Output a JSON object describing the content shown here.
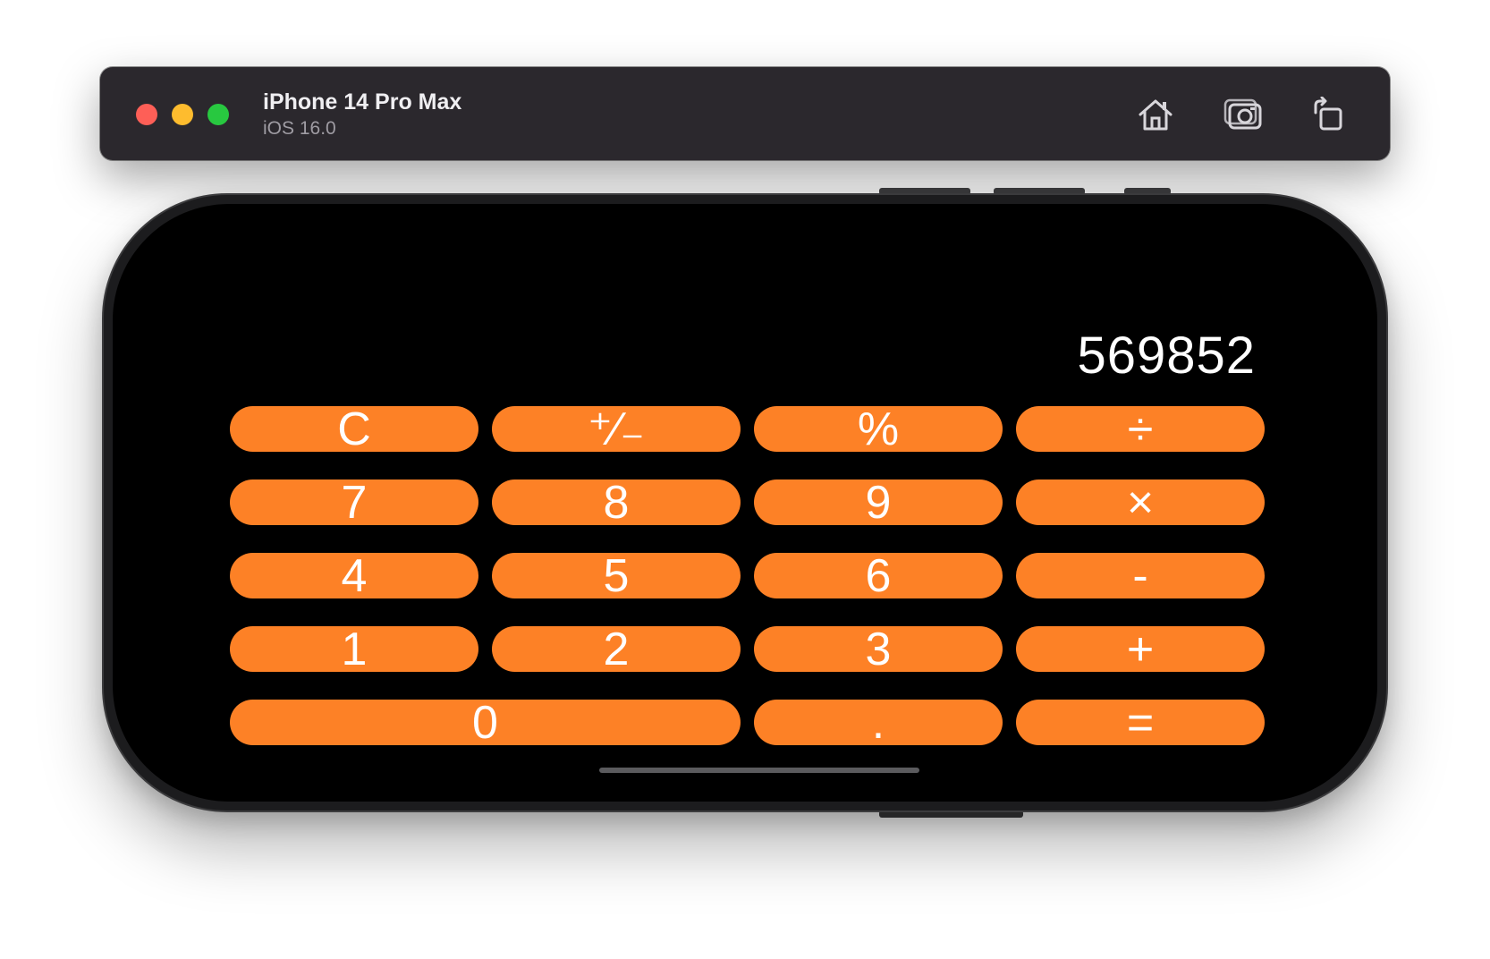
{
  "window": {
    "device_name": "iPhone 14 Pro Max",
    "os_version": "iOS 16.0",
    "toolbar_icons": [
      "home-icon",
      "screenshot-icon",
      "rotate-icon"
    ]
  },
  "calculator": {
    "display": "569852",
    "accent_color": "#fd8126",
    "rows": [
      [
        {
          "label": "C",
          "name": "clear"
        },
        {
          "label": "⁺∕₋",
          "name": "plus-minus"
        },
        {
          "label": "%",
          "name": "percent"
        },
        {
          "label": "÷",
          "name": "divide"
        }
      ],
      [
        {
          "label": "7",
          "name": "digit-7"
        },
        {
          "label": "8",
          "name": "digit-8"
        },
        {
          "label": "9",
          "name": "digit-9"
        },
        {
          "label": "×",
          "name": "multiply"
        }
      ],
      [
        {
          "label": "4",
          "name": "digit-4"
        },
        {
          "label": "5",
          "name": "digit-5"
        },
        {
          "label": "6",
          "name": "digit-6"
        },
        {
          "label": "-",
          "name": "subtract"
        }
      ],
      [
        {
          "label": "1",
          "name": "digit-1"
        },
        {
          "label": "2",
          "name": "digit-2"
        },
        {
          "label": "3",
          "name": "digit-3"
        },
        {
          "label": "+",
          "name": "add"
        }
      ],
      [
        {
          "label": "0",
          "name": "digit-0",
          "wide": true
        },
        {
          "label": ".",
          "name": "decimal"
        },
        {
          "label": "=",
          "name": "equals"
        }
      ]
    ]
  }
}
